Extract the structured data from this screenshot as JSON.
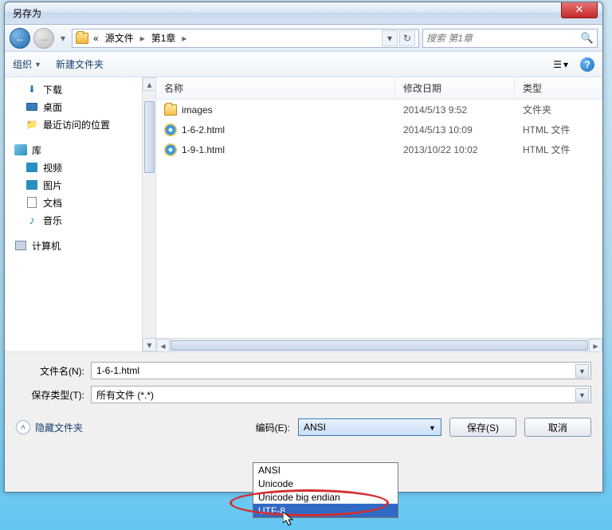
{
  "title": "另存为",
  "nav": {
    "back": "←",
    "fwd": "→",
    "crumb_prefix": "«",
    "crumb1": "源文件",
    "crumb2": "第1章",
    "sep": "▸",
    "refresh": "↻",
    "dd": "▾"
  },
  "search": {
    "placeholder": "搜索 第1章"
  },
  "toolbar": {
    "organize": "组织",
    "newfolder": "新建文件夹",
    "view_dd": "▾",
    "help": "?"
  },
  "sidebar": {
    "downloads": "下载",
    "desktop": "桌面",
    "recent": "最近访问的位置",
    "libraries": "库",
    "videos": "视频",
    "pictures": "图片",
    "documents": "文档",
    "music": "音乐",
    "computer": "计算机"
  },
  "columns": {
    "name": "名称",
    "modified": "修改日期",
    "type": "类型"
  },
  "rows": [
    {
      "name": "images",
      "date": "2014/5/13 9:52",
      "type": "文件夹",
      "icon": "folder"
    },
    {
      "name": "1-6-2.html",
      "date": "2014/5/13 10:09",
      "type": "HTML 文件",
      "icon": "ie"
    },
    {
      "name": "1-9-1.html",
      "date": "2013/10/22 10:02",
      "type": "HTML 文件",
      "icon": "ie"
    }
  ],
  "filename_label": "文件名(N):",
  "filename_value": "1-6-1.html",
  "filetype_label": "保存类型(T):",
  "filetype_value": "所有文件  (*.*)",
  "hide_folders": "隐藏文件夹",
  "encoding_label": "编码(E):",
  "encoding_value": "ANSI",
  "encoding_options": [
    "ANSI",
    "Unicode",
    "Unicode big endian",
    "UTF-8"
  ],
  "save_btn": "保存(S)",
  "cancel_btn": "取消"
}
